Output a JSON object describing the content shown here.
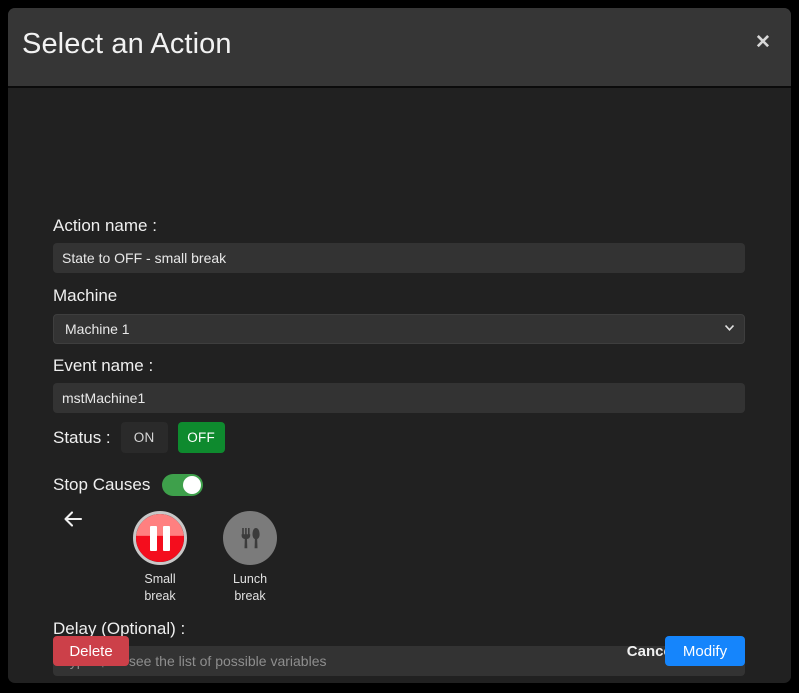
{
  "dialog": {
    "title": "Select an Action",
    "close_icon": "close-icon"
  },
  "form": {
    "action_name": {
      "label": "Action name :",
      "value": "State to OFF - small break",
      "placeholder": ""
    },
    "machine": {
      "label": "Machine",
      "value": "Machine 1",
      "options": [
        "Machine 1"
      ]
    },
    "event_name": {
      "label": "Event name :",
      "value": "mstMachine1",
      "placeholder": ""
    },
    "status": {
      "label": "Status :",
      "on_label": "ON",
      "off_label": "OFF",
      "selected": "OFF",
      "active_color": "#0e8a2e"
    },
    "stop_causes": {
      "label": "Stop Causes",
      "toggle_on": true,
      "toggle_color": "#3ea04b",
      "prev_icon": "arrow-left-icon",
      "items": [
        {
          "label_line1": "Small",
          "label_line2": "break",
          "icon": "pause-icon",
          "color": "#f40d1d",
          "selected": true
        },
        {
          "label_line1": "Lunch",
          "label_line2": "break",
          "icon": "cutlery-icon",
          "color": "#7b7b7b",
          "selected": false
        }
      ]
    },
    "delay": {
      "label": "Delay (Optional) :",
      "value": "",
      "placeholder": "Type '$' to see the list of possible variables"
    }
  },
  "footer": {
    "delete_label": "Delete",
    "cancel_label": "Cancel",
    "modify_label": "Modify",
    "delete_color": "#cc4049",
    "modify_color": "#1585fc"
  }
}
